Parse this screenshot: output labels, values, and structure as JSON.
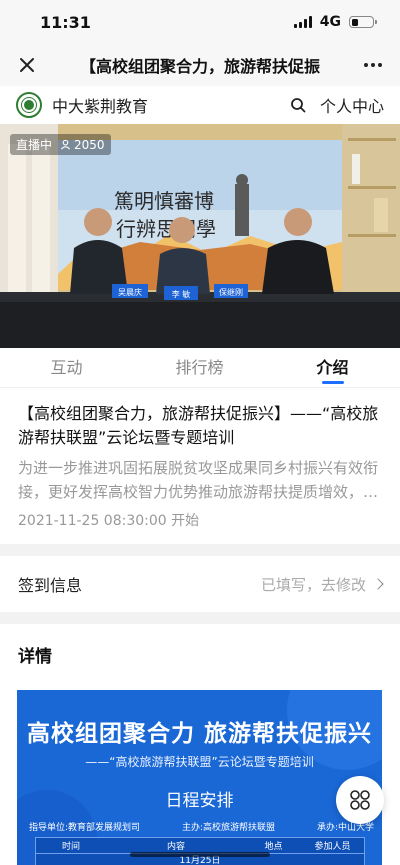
{
  "status_bar": {
    "time": "11:31",
    "network": "4G",
    "battery_level": 0.3
  },
  "title_bar": {
    "title": "【高校组团聚合力，旅游帮扶促振",
    "close_icon": "close-icon",
    "more_icon": "more-icon"
  },
  "site_header": {
    "name": "中大紫荆教育",
    "search_icon": "search-icon",
    "user_center": "个人中心"
  },
  "video": {
    "live_status": "直播中",
    "viewer_count": "2050",
    "backdrop_calligraphy_left": "篤明慎審博",
    "backdrop_calligraphy_right": "行辨思問學",
    "nameplates": [
      "吴晨庆",
      "李  敏",
      "保继刚"
    ]
  },
  "tabs": [
    {
      "label": "互动",
      "active": false
    },
    {
      "label": "排行榜",
      "active": false
    },
    {
      "label": "介绍",
      "active": true
    }
  ],
  "intro": {
    "title": "【高校组团聚合力，旅游帮扶促振兴】——“高校旅游帮扶联盟”云论坛暨专题培训",
    "description": "为进一步推进巩固拓展脱贫攻坚成果同乡村振兴有效衔接，更好发挥高校智力优势推动旅游帮扶提质增效，…",
    "start_time": "2021-11-25 08:30:00 开始"
  },
  "checkin": {
    "label": "签到信息",
    "status": "已填写，去修改"
  },
  "details": {
    "heading": "详情",
    "poster": {
      "title": "高校组团聚合力 旅游帮扶促振兴",
      "subtitle": "——“高校旅游帮扶联盟”云论坛暨专题培训",
      "schedule": "日程安排",
      "org_guide": "指导单位:教育部发展规划司",
      "org_host": "主办:高校旅游帮扶联盟",
      "org_undertake": "承办:中山大学",
      "table_headers": [
        "时间",
        "内容",
        "地点",
        "参加人员"
      ],
      "table_first_row": "11月25日"
    }
  },
  "floating_button_icon": "grid-menu-icon",
  "colors": {
    "accent": "#1e6fff",
    "poster_blue": "#1a67d6",
    "logo_green": "#2e7d32"
  }
}
